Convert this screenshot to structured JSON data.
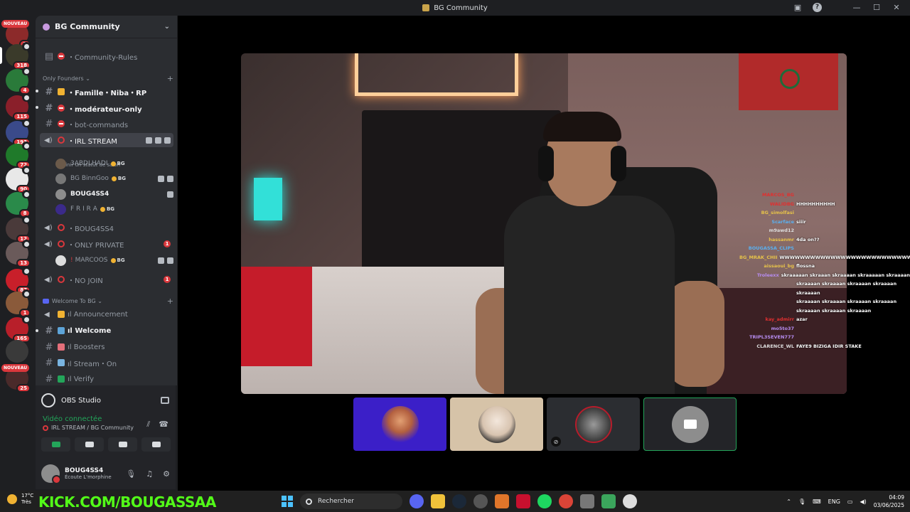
{
  "window": {
    "title": "BG Community"
  },
  "servers": [
    {
      "badge": "3",
      "nouveau": "NOUVEAU",
      "color": "#8c2a2a"
    },
    {
      "badge": "318",
      "color": "#3a3a2a"
    },
    {
      "badge": "4",
      "color": "#2a7a3a"
    },
    {
      "badge": "115",
      "color": "#8a1f2a"
    },
    {
      "badge": "193",
      "color": "#3a4a8a"
    },
    {
      "badge": "72",
      "color": "#1f7a2a"
    },
    {
      "badge": "90",
      "color": "#e8e8e8"
    },
    {
      "badge": "8",
      "color": "#2a8a4a"
    },
    {
      "badge": "12",
      "color": "#4a3a3a"
    },
    {
      "badge": "13",
      "color": "#6a5a5a"
    },
    {
      "badge": "87",
      "color": "#c81f2a"
    },
    {
      "badge": "1",
      "color": "#8a5a3a"
    },
    {
      "badge": "165",
      "color": "#b81f2a"
    },
    {
      "badge": "",
      "color": "#3a3a3a"
    },
    {
      "badge": "25",
      "nouveau": "NOUVEAU",
      "color": "#4a2a2a"
    }
  ],
  "guild": {
    "name": "BG Community"
  },
  "channels": {
    "rules": "・Community-Rules",
    "cat_founders": "Only Founders",
    "famille": "・Famille・Niba・RP",
    "moderateur": "・modérateur-only",
    "bot": "・bot-commands",
    "irl": "・IRL STREAM",
    "irl_status": "Définir un statut de salon",
    "boug_voice": "・BOUG4SS4",
    "only_private": "・ONLY PRIVATE",
    "only_private_badge": "1",
    "no_join": "・NO JOIN",
    "no_join_badge": "1",
    "cat_welcome": "Welcome To BG",
    "announcement": "ıl Announcement",
    "welcome": "ıl Welcome",
    "boosters": "ıl Boosters",
    "stream_on": "ıl Stream・On",
    "verify": "ıl Verify"
  },
  "voice_users": [
    {
      "name": "3ABDLHADI",
      "tag": "BG",
      "color": "#6b5a4a"
    },
    {
      "name": "BG BinnGoo",
      "tag": "BG",
      "color": "#777"
    },
    {
      "name": "BOUG4SS4",
      "tag": "",
      "color": "#8d8d8d"
    },
    {
      "name": "F R I R A",
      "tag": "BG",
      "color": "#3b2a8a"
    }
  ],
  "private_user": {
    "name": "MARCOOS",
    "tag": "BG"
  },
  "obs": {
    "label": "OBS Studio"
  },
  "voice": {
    "connected": "Vidéo connectée",
    "location": "IRL STREAM / BG Community"
  },
  "account": {
    "name": "BOUG4SS4",
    "activity": "Écoute L'morphine"
  },
  "chat": [
    {
      "name": "MARCOS_BG",
      "msg": "",
      "color": "#e03030"
    },
    {
      "name": "WALIDBG",
      "msg": "HHHHHHHHHH",
      "color": "#e03030"
    },
    {
      "name": "BG_simolfasi",
      "msg": "",
      "color": "#e6c24a"
    },
    {
      "name": "Scarface",
      "msg": "siiir",
      "color": "#5ab0f0"
    },
    {
      "name": "m9awd12",
      "msg": "",
      "color": "#dddddd"
    },
    {
      "name": "hassanmr",
      "msg": "4da on??",
      "color": "#e6c24a"
    },
    {
      "name": "BOUGASSA_CLIPS",
      "msg": "",
      "color": "#5ab0f0"
    },
    {
      "name": "BG_MRAK_CHII",
      "msg": "WWWWWWWWWWWWWWWWWWWWWWWWWWW",
      "color": "#e6c24a"
    },
    {
      "name": "aissaoui_bg",
      "msg": "flossna",
      "color": "#e6c24a"
    },
    {
      "name": "Troleexx",
      "msg": "skraaaaan skraaan skraaaan skraaaaan skraaaan",
      "color": "#b68cf0"
    },
    {
      "name": "",
      "msg": "skraaaan skraaaan skraaaan skraaaan skraaaan",
      "color": "#ffffff"
    },
    {
      "name": "",
      "msg": "skraaaan skraaaan skraaaan skraaaan",
      "color": "#ffffff"
    },
    {
      "name": "",
      "msg": "skraaaan skraaaan skraaaan",
      "color": "#ffffff"
    },
    {
      "name": "kay_admirr",
      "msg": "azar",
      "color": "#e03030"
    },
    {
      "name": "mo5to37",
      "msg": "",
      "color": "#b68cf0"
    },
    {
      "name": "TRIPL3SEVEN777",
      "msg": "",
      "color": "#b68cf0"
    },
    {
      "name": "CLARENCE_WL",
      "msg": "FAYE9 BIZIGA IDIR STAKE",
      "color": "#dddddd"
    }
  ],
  "taskbar": {
    "temp": "17°C",
    "weather": "Très",
    "kick": "KICK.COM/BOUGASSAA",
    "search_placeholder": "Rechercher",
    "lang": "ENG",
    "time": "04:09",
    "date": "03/06/2025"
  }
}
